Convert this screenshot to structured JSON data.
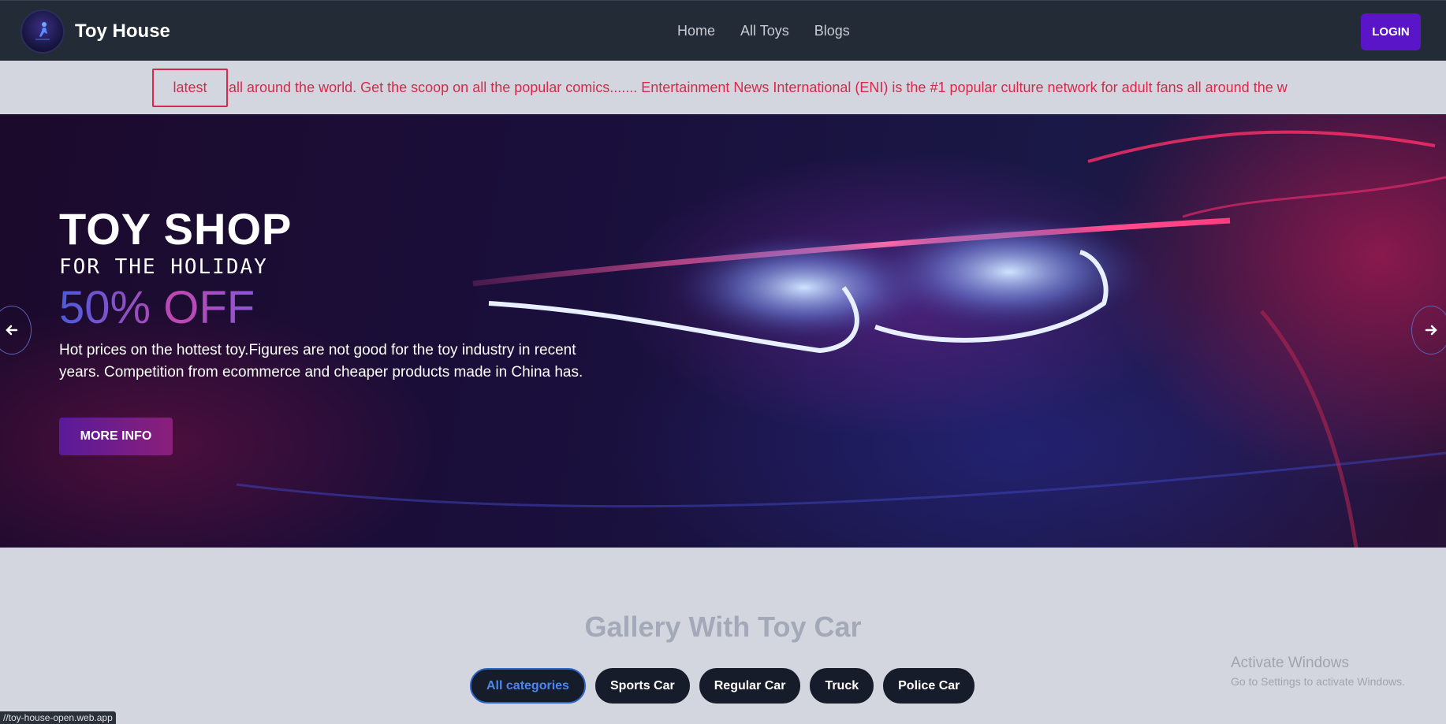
{
  "navbar": {
    "brand": "Toy House",
    "links": [
      "Home",
      "All Toys",
      "Blogs"
    ],
    "login_label": "LOGIN"
  },
  "ticker": {
    "label": "latest",
    "text": "all around the world. Get the scoop on all the popular comics....... Entertainment News International (ENI) is the #1 popular culture network for adult fans all around the w"
  },
  "hero": {
    "title": "TOY SHOP",
    "subtitle": "FOR THE HOLIDAY",
    "offer": "50% OFF",
    "description": "Hot prices on the hottest toy.Figures are not good for the toy industry in recent years. Competition from ecommerce and cheaper products made in China has.",
    "button_label": "MORE INFO",
    "prev_icon": "arrow-left-icon",
    "next_icon": "arrow-right-icon"
  },
  "gallery": {
    "title": "Gallery With Toy Car",
    "categories": [
      "All categories",
      "Sports Car",
      "Regular Car",
      "Truck",
      "Police Car"
    ],
    "active_category": "All categories"
  },
  "overlay": {
    "activate_title": "Activate Windows",
    "activate_sub": "Go to Settings to activate Windows.",
    "status_url": "//toy-house-open.web.app"
  },
  "colors": {
    "navbar_bg": "#222b36",
    "accent": "#5b15c8",
    "ticker_red": "#d6294b",
    "page_bg": "#d3d6de"
  }
}
